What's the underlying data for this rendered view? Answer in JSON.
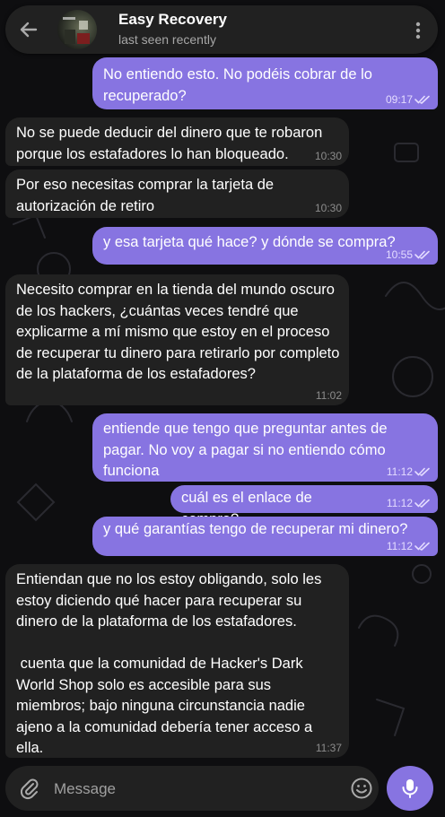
{
  "header": {
    "title": "Easy Recovery",
    "status": "last seen recently",
    "back_icon": "arrow-left-icon",
    "menu_icon": "more-vertical-icon"
  },
  "messages": [
    {
      "dir": "out",
      "text": "No entiendo esto. No podéis cobrar de lo recuperado?",
      "time": "09:17",
      "read": true
    },
    {
      "dir": "in",
      "text": "No se puede deducir del dinero que te robaron porque los estafadores lo han bloqueado.",
      "time": "10:30"
    },
    {
      "dir": "in",
      "text": "Por eso necesitas comprar la tarjeta de autorización de retiro",
      "time": "10:30"
    },
    {
      "dir": "out",
      "text": "y esa tarjeta qué hace? y dónde se compra?",
      "time": "10:55",
      "read": true
    },
    {
      "dir": "in",
      "text": "Necesito comprar en la tienda del mundo oscuro de los hackers, ¿cuántas veces tendré que explicarme a mí mismo que estoy en el proceso de recuperar tu dinero para retirarlo por completo de la plataforma de los estafadores?",
      "time": "11:02"
    },
    {
      "dir": "out",
      "text": "entiende que tengo que preguntar antes de pagar. No voy a pagar si no entiendo cómo funciona",
      "time": "11:12",
      "read": true
    },
    {
      "dir": "out",
      "text": "cuál es el enlace de compra?",
      "time": "11:12",
      "read": true
    },
    {
      "dir": "out",
      "text": "y qué garantías tengo de recuperar mi dinero?",
      "time": "11:12",
      "read": true
    },
    {
      "dir": "in",
      "text": "Entiendan que no los estoy obligando, solo les estoy diciendo qué hacer para recuperar su dinero de la plataforma de los estafadores.\n\n cuenta que la comunidad de Hacker's Dark World Shop solo es accesible para sus miembros; bajo ninguna circunstancia nadie ajeno a la comunidad debería tener acceso a ella.",
      "time": "11:37"
    }
  ],
  "composer": {
    "placeholder": "Message",
    "attach_icon": "paperclip-icon",
    "emoji_icon": "smiley-icon",
    "mic_icon": "microphone-icon"
  },
  "colors": {
    "background": "#0e0e10",
    "incoming_bubble": "#212121",
    "outgoing_bubble": "#8774e1",
    "header": "#212121"
  }
}
